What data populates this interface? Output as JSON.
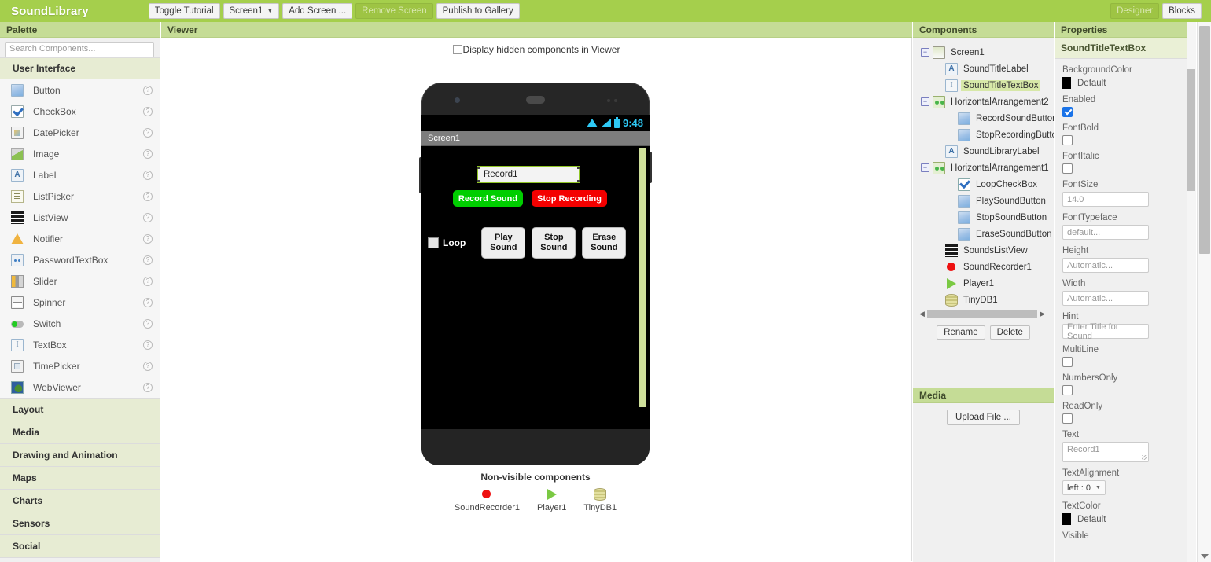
{
  "topbar": {
    "app_title": "SoundLibrary",
    "buttons": [
      {
        "label": "Toggle Tutorial",
        "name": "toggle-tutorial-button",
        "disabled": false,
        "caret": false
      },
      {
        "label": "Screen1",
        "name": "screen-selector-button",
        "disabled": false,
        "caret": true
      },
      {
        "label": "Add Screen ...",
        "name": "add-screen-button",
        "disabled": false,
        "caret": false
      },
      {
        "label": "Remove Screen",
        "name": "remove-screen-button",
        "disabled": true,
        "caret": false
      },
      {
        "label": "Publish to Gallery",
        "name": "publish-to-gallery-button",
        "disabled": false,
        "caret": false
      }
    ],
    "right_buttons": [
      {
        "label": "Designer",
        "name": "designer-tab-button",
        "disabled": true
      },
      {
        "label": "Blocks",
        "name": "blocks-tab-button",
        "disabled": false
      }
    ]
  },
  "palette": {
    "header": "Palette",
    "search_placeholder": "Search Components...",
    "open_section": "User Interface",
    "items": [
      {
        "label": "Button",
        "icon": "button-icon",
        "icon_class": "ic-button",
        "help": "?"
      },
      {
        "label": "CheckBox",
        "icon": "checkbox-icon",
        "icon_class": "ic-checkbox",
        "help": "?"
      },
      {
        "label": "DatePicker",
        "icon": "datepicker-icon",
        "icon_class": "ic-datepicker",
        "help": "?"
      },
      {
        "label": "Image",
        "icon": "image-icon",
        "icon_class": "ic-image",
        "help": "?"
      },
      {
        "label": "Label",
        "icon": "label-icon",
        "icon_class": "ic-label",
        "help": "?",
        "glyph": "A"
      },
      {
        "label": "ListPicker",
        "icon": "listpicker-icon",
        "icon_class": "ic-listpicker",
        "help": "?"
      },
      {
        "label": "ListView",
        "icon": "listview-icon",
        "icon_class": "ic-listview",
        "help": "?"
      },
      {
        "label": "Notifier",
        "icon": "notifier-icon",
        "icon_class": "ic-notifier",
        "help": "?"
      },
      {
        "label": "PasswordTextBox",
        "icon": "passwordtextbox-icon",
        "icon_class": "ic-password",
        "help": "?"
      },
      {
        "label": "Slider",
        "icon": "slider-icon",
        "icon_class": "ic-slider",
        "help": "?"
      },
      {
        "label": "Spinner",
        "icon": "spinner-icon",
        "icon_class": "ic-spinner",
        "help": "?"
      },
      {
        "label": "Switch",
        "icon": "switch-icon",
        "icon_class": "ic-switch",
        "help": "?"
      },
      {
        "label": "TextBox",
        "icon": "textbox-icon",
        "icon_class": "ic-textbox",
        "help": "?",
        "glyph": "I"
      },
      {
        "label": "TimePicker",
        "icon": "timepicker-icon",
        "icon_class": "ic-timepicker",
        "help": "?"
      },
      {
        "label": "WebViewer",
        "icon": "webviewer-icon",
        "icon_class": "ic-webviewer",
        "help": "?"
      }
    ],
    "categories": [
      {
        "label": "Layout",
        "name": "palette-category-layout"
      },
      {
        "label": "Media",
        "name": "palette-category-media"
      },
      {
        "label": "Drawing and Animation",
        "name": "palette-category-drawing-and-animation"
      },
      {
        "label": "Maps",
        "name": "palette-category-maps"
      },
      {
        "label": "Charts",
        "name": "palette-category-charts"
      },
      {
        "label": "Sensors",
        "name": "palette-category-sensors"
      },
      {
        "label": "Social",
        "name": "palette-category-social"
      }
    ]
  },
  "viewer": {
    "header": "Viewer",
    "hidden_components_label": "Display hidden components in Viewer",
    "hidden_components_checked": false,
    "phone": {
      "status_time": "9:48",
      "title": "Screen1",
      "textbox_value": "Record1",
      "record_button": "Record Sound",
      "record_button_color": "#00ce00",
      "stop_button": "Stop Recording",
      "stop_button_color": "#f40000",
      "loop_label": "Loop",
      "loop_checked": false,
      "action_buttons": [
        {
          "line1": "Play",
          "line2": "Sound",
          "name": "play-sound-button"
        },
        {
          "line1": "Stop",
          "line2": "Sound",
          "name": "stop-sound-button"
        },
        {
          "line1": "Erase",
          "line2": "Sound",
          "name": "erase-sound-button"
        }
      ]
    },
    "nonvisible": {
      "header": "Non-visible components",
      "items": [
        {
          "label": "SoundRecorder1",
          "icon": "sound-recorder-icon",
          "icon_class": "ic-recorder"
        },
        {
          "label": "Player1",
          "icon": "player-icon",
          "icon_class": "ic-player"
        },
        {
          "label": "TinyDB1",
          "icon": "tinydb-icon",
          "icon_class": "ic-tinydb"
        }
      ]
    }
  },
  "components": {
    "header": "Components",
    "tree": [
      {
        "label": "Screen1",
        "indent": 0,
        "expander": "−",
        "icon": "screen-icon",
        "icon_class": "ic-screen",
        "selected": false
      },
      {
        "label": "SoundTitleLabel",
        "indent": 1,
        "expander": "",
        "icon": "label-icon",
        "icon_class": "ic-label",
        "glyph": "A",
        "selected": false
      },
      {
        "label": "SoundTitleTextBox",
        "indent": 1,
        "expander": "",
        "icon": "textbox-icon",
        "icon_class": "ic-textbox",
        "glyph": "I",
        "selected": true
      },
      {
        "label": "HorizontalArrangement2",
        "indent": 0,
        "expander": "−",
        "icon": "horizontal-arrangement-icon",
        "icon_class": "ic-harr",
        "selected": false
      },
      {
        "label": "RecordSoundButton",
        "indent": 2,
        "expander": "",
        "icon": "button-icon",
        "icon_class": "ic-button",
        "selected": false
      },
      {
        "label": "StopRecordingButton",
        "indent": 2,
        "expander": "",
        "icon": "button-icon",
        "icon_class": "ic-button",
        "selected": false
      },
      {
        "label": "SoundLibraryLabel",
        "indent": 1,
        "expander": "",
        "icon": "label-icon",
        "icon_class": "ic-label",
        "glyph": "A",
        "selected": false
      },
      {
        "label": "HorizontalArrangement1",
        "indent": 0,
        "expander": "−",
        "icon": "horizontal-arrangement-icon",
        "icon_class": "ic-harr",
        "selected": false
      },
      {
        "label": "LoopCheckBox",
        "indent": 2,
        "expander": "",
        "icon": "checkbox-icon",
        "icon_class": "ic-checked",
        "selected": false
      },
      {
        "label": "PlaySoundButton",
        "indent": 2,
        "expander": "",
        "icon": "button-icon",
        "icon_class": "ic-button",
        "selected": false
      },
      {
        "label": "StopSoundButton",
        "indent": 2,
        "expander": "",
        "icon": "button-icon",
        "icon_class": "ic-button",
        "selected": false
      },
      {
        "label": "EraseSoundButton",
        "indent": 2,
        "expander": "",
        "icon": "button-icon",
        "icon_class": "ic-button",
        "selected": false
      },
      {
        "label": "SoundsListView",
        "indent": 1,
        "expander": "",
        "icon": "listview-icon",
        "icon_class": "ic-listview",
        "selected": false
      },
      {
        "label": "SoundRecorder1",
        "indent": 1,
        "expander": "",
        "icon": "sound-recorder-icon",
        "icon_class": "ic-recorder",
        "selected": false
      },
      {
        "label": "Player1",
        "indent": 1,
        "expander": "",
        "icon": "player-icon",
        "icon_class": "ic-player",
        "selected": false
      },
      {
        "label": "TinyDB1",
        "indent": 1,
        "expander": "",
        "icon": "tinydb-icon",
        "icon_class": "ic-tinydb",
        "selected": false
      }
    ],
    "rename_button": "Rename",
    "delete_button": "Delete"
  },
  "media": {
    "header": "Media",
    "upload_button": "Upload File ..."
  },
  "properties": {
    "header": "Properties",
    "selected_component": "SoundTitleTextBox",
    "rows": [
      {
        "name": "BackgroundColor",
        "type": "color",
        "value": "Default",
        "swatch": "#000000"
      },
      {
        "name": "Enabled",
        "type": "checkbox",
        "checked": true
      },
      {
        "name": "FontBold",
        "type": "checkbox",
        "checked": false
      },
      {
        "name": "FontItalic",
        "type": "checkbox",
        "checked": false
      },
      {
        "name": "FontSize",
        "type": "input",
        "value": "14.0"
      },
      {
        "name": "FontTypeface",
        "type": "input",
        "value": "default..."
      },
      {
        "name": "Height",
        "type": "input",
        "value": "Automatic..."
      },
      {
        "name": "Width",
        "type": "input",
        "value": "Automatic..."
      },
      {
        "name": "Hint",
        "type": "input",
        "value": "Enter Title for Sound"
      },
      {
        "name": "MultiLine",
        "type": "checkbox",
        "checked": false
      },
      {
        "name": "NumbersOnly",
        "type": "checkbox",
        "checked": false
      },
      {
        "name": "ReadOnly",
        "type": "checkbox",
        "checked": false
      },
      {
        "name": "Text",
        "type": "textarea",
        "value": "Record1"
      },
      {
        "name": "TextAlignment",
        "type": "select",
        "value": "left : 0"
      },
      {
        "name": "TextColor",
        "type": "color",
        "value": "Default",
        "swatch": "#000000"
      },
      {
        "name": "Visible",
        "type": "label-only",
        "value": ""
      }
    ]
  },
  "colors": {
    "brand_green": "#a5cf4c",
    "panel_header": "#c5dc96",
    "section_header": "#e7ecd3",
    "selection": "#d7e8a8"
  }
}
